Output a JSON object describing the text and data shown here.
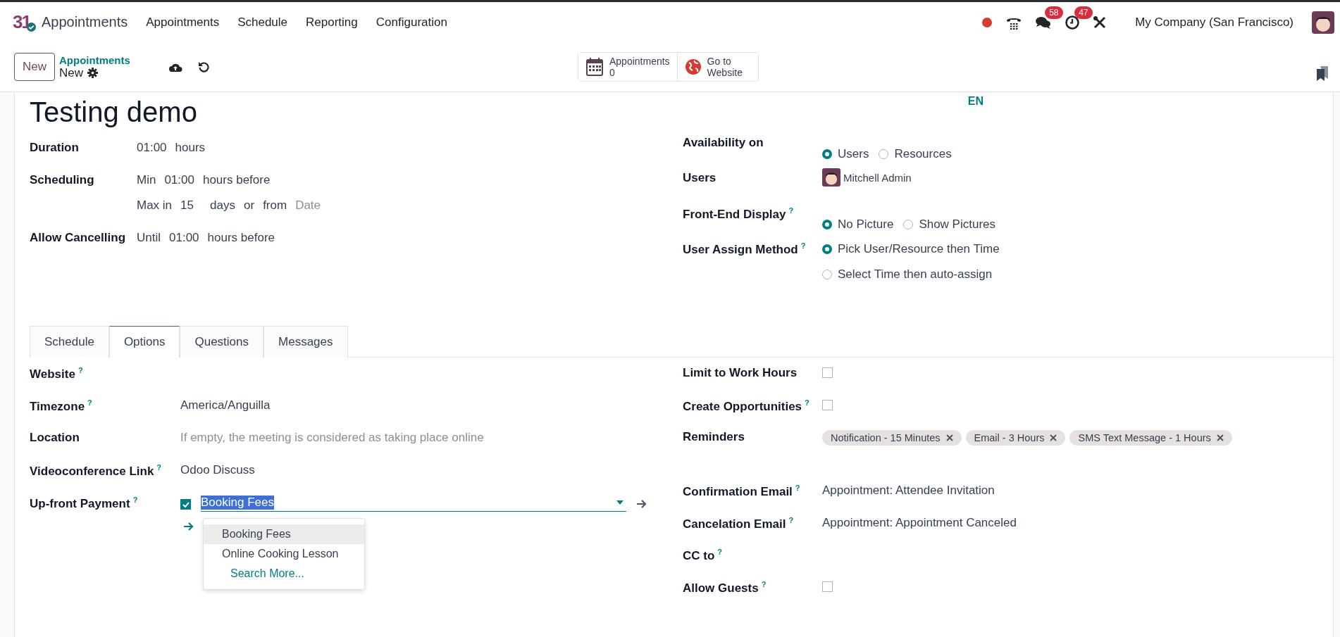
{
  "navbar": {
    "logo_text": "31",
    "app_name": "Appointments",
    "menu": [
      "Appointments",
      "Schedule",
      "Reporting",
      "Configuration"
    ],
    "messages_badge": "58",
    "activities_badge": "47",
    "company": "My Company (San Francisco)"
  },
  "control_panel": {
    "new_button": "New",
    "breadcrumb_parent": "Appointments",
    "breadcrumb_current": "New",
    "stat_buttons": [
      {
        "kind": "counter",
        "label": "Appointments",
        "value": "0"
      },
      {
        "kind": "link",
        "label": "Go to Website"
      }
    ]
  },
  "form": {
    "title": "Testing demo",
    "language": "EN",
    "left_fields": [
      {
        "label": "Duration",
        "lines": [
          [
            {
              "kind": "value",
              "text": "01:00"
            },
            {
              "kind": "text",
              "text": "hours"
            }
          ]
        ]
      },
      {
        "label": "Scheduling",
        "lines": [
          [
            {
              "kind": "text",
              "text": "Min"
            },
            {
              "kind": "value",
              "text": "01:00"
            },
            {
              "kind": "text",
              "text": "hours before"
            }
          ],
          [
            {
              "kind": "text",
              "text": "Max in"
            },
            {
              "kind": "value",
              "text": "15"
            },
            {
              "kind": "text",
              "text": "days"
            },
            {
              "kind": "text",
              "text": "or"
            },
            {
              "kind": "text",
              "text": "from"
            },
            {
              "kind": "placeholder",
              "text": "Date"
            }
          ]
        ]
      },
      {
        "label": "Allow Cancelling",
        "lines": [
          [
            {
              "kind": "text",
              "text": "Until"
            },
            {
              "kind": "value",
              "text": "01:00"
            },
            {
              "kind": "text",
              "text": "hours before"
            }
          ]
        ]
      }
    ],
    "right_fields": [
      {
        "label": "Availability on",
        "kind": "radio",
        "options": [
          {
            "label": "Users",
            "selected": true
          },
          {
            "label": "Resources",
            "selected": false
          }
        ]
      },
      {
        "label": "Users",
        "kind": "user",
        "value": "Mitchell Admin"
      },
      {
        "label": "Front-End Display",
        "help": "?",
        "kind": "radio",
        "options": [
          {
            "label": "No Picture",
            "selected": true
          },
          {
            "label": "Show Pictures",
            "selected": false
          }
        ]
      },
      {
        "label": "User Assign Method",
        "help": "?",
        "kind": "radio_list",
        "options": [
          {
            "label": "Pick User/Resource then Time",
            "selected": true
          },
          {
            "label": "Select Time then auto-assign",
            "selected": false
          }
        ]
      }
    ]
  },
  "tabs": [
    {
      "label": "Schedule",
      "selected": false
    },
    {
      "label": "Options",
      "selected": true
    },
    {
      "label": "Questions",
      "selected": false
    },
    {
      "label": "Messages",
      "selected": false
    }
  ],
  "options_left": [
    {
      "label": "Website",
      "help": "?",
      "kind": "empty"
    },
    {
      "label": "Timezone",
      "help": "?",
      "kind": "text",
      "value": "America/Anguilla"
    },
    {
      "label": "Location",
      "kind": "placeholder",
      "placeholder": "If empty, the meeting is considered as taking place online"
    },
    {
      "label": "Videoconference Link",
      "help": "?",
      "kind": "text",
      "value": "Odoo Discuss"
    },
    {
      "label": "Up-front Payment",
      "help": "?",
      "kind": "payment",
      "checked": true,
      "value": "Booking Fees",
      "dropdown": [
        {
          "label": "Booking Fees",
          "selected": true
        },
        {
          "label": "Online Cooking Lesson",
          "selected": false
        }
      ],
      "search_more": "Search More..."
    }
  ],
  "options_right": [
    {
      "label": "Limit to Work Hours",
      "kind": "checkbox",
      "checked": false
    },
    {
      "label": "Create Opportunities",
      "help": "?",
      "kind": "checkbox",
      "checked": false
    },
    {
      "label": "Reminders",
      "kind": "tags",
      "tags": [
        "Notification - 15 Minutes",
        "Email - 3 Hours",
        "SMS Text Message - 1 Hours"
      ]
    },
    {
      "label": "Confirmation Email",
      "help": "?",
      "kind": "text",
      "value": "Appointment: Attendee Invitation"
    },
    {
      "label": "Cancelation Email",
      "help": "?",
      "kind": "text",
      "value": "Appointment: Appointment Canceled"
    },
    {
      "label": "CC to",
      "help": "?",
      "kind": "empty"
    },
    {
      "label": "Allow Guests",
      "help": "?",
      "kind": "checkbox",
      "checked": false
    }
  ]
}
